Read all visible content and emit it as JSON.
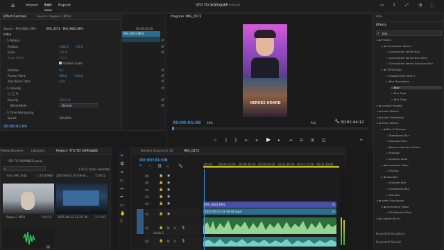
{
  "menu": {
    "import": "Import",
    "edit": "Edit",
    "export": "Export"
  },
  "title": "ЧТО ТО ХОРОШЕЕ",
  "title_status": "Edited",
  "effect_controls": {
    "tabs": [
      "Effect Controls",
      "Source: Видео 1.MOV"
    ],
    "source_path": "Source · MVI_9661.MP4",
    "seq_path": "IMG_0572 · MVI_9661.MP4",
    "time_ruler": "00:00:30:00",
    "clip_name": "MVI_9661.MP4",
    "section_video": "Video",
    "fx_motion": "Motion",
    "position_label": "Position",
    "position_x": "1080,0",
    "position_y": "729,0",
    "scale_label": "Scale",
    "scale_val": "117,0",
    "scale_width_label": "Scale Width",
    "scale_width_val": "100,0",
    "uniform_scale": "Uniform Scale",
    "rotation_label": "Rotation",
    "rotation_val": "0,0",
    "anchor_label": "Anchor Point",
    "anchor_x": "960,0",
    "anchor_y": "540,0",
    "antiflicker_label": "Anti-flicker Filter",
    "antiflicker_val": "0,00",
    "fx_opacity": "Opacity",
    "opacity_label": "Opacity",
    "opacity_val": "100,0 %",
    "blend_label": "Blend Mode",
    "blend_val": "Normal",
    "fx_remap": "Time Remapping",
    "speed_label": "Speed",
    "speed_val": "100,00%",
    "footer_tc": "00:00:01:06"
  },
  "program": {
    "title": "Program: IMG_0572",
    "tc_left": "00:00:01:06",
    "zoom": "16%",
    "quality": "Full",
    "tc_right": "00:01:44:12",
    "poster_text": "HEROES HOARD"
  },
  "info": {
    "title": "Info"
  },
  "effects": {
    "title": "Effects",
    "search": "blur",
    "items": [
      {
        "label": "Presets",
        "lvl": 0,
        "sel": false
      },
      {
        "label": "Convolution Kernel",
        "lvl": 1,
        "sel": false
      },
      {
        "label": "Convolution Kernel Blur",
        "lvl": 2,
        "sel": false
      },
      {
        "label": "Convolution Kernel Blur More",
        "lvl": 2,
        "sel": false
      },
      {
        "label": "Convolution Kernel Gaussian Blur",
        "lvl": 2,
        "sel": false
      },
      {
        "label": "ПЕРЕХОДЫ",
        "lvl": 1,
        "sel": false
      },
      {
        "label": "TRANSITION PACK 3",
        "lvl": 2,
        "sel": false
      },
      {
        "label": "Blur Transitions",
        "lvl": 2,
        "sel": false
      },
      {
        "label": "Blur",
        "lvl": 3,
        "sel": true
      },
      {
        "label": "Blur Fade",
        "lvl": 3,
        "sel": false
      },
      {
        "label": "Blur Glow",
        "lvl": 3,
        "sel": false
      },
      {
        "label": "Lumetri Presets",
        "lvl": 0,
        "sel": false
      },
      {
        "label": "Audio Effects",
        "lvl": 0,
        "sel": false
      },
      {
        "label": "Audio Transitions",
        "lvl": 0,
        "sel": false
      },
      {
        "label": "Video Effects",
        "lvl": 0,
        "sel": false
      },
      {
        "label": "Blur & Sharpen",
        "lvl": 1,
        "sel": false
      },
      {
        "label": "Directional Blur",
        "lvl": 2,
        "sel": false
      },
      {
        "label": "Gaussian Blur",
        "lvl": 2,
        "sel": false
      },
      {
        "label": "Reduce Interlace Flicker",
        "lvl": 2,
        "sel": false
      },
      {
        "label": "Sharpen",
        "lvl": 2,
        "sel": false
      },
      {
        "label": "Unsharp Mask",
        "lvl": 2,
        "sel": false
      },
      {
        "label": "Immersive Video",
        "lvl": 1,
        "sel": false
      },
      {
        "label": "VR Blur",
        "lvl": 2,
        "sel": false
      },
      {
        "label": "Obsolete",
        "lvl": 1,
        "sel": false
      },
      {
        "label": "Channel Blur",
        "lvl": 2,
        "sel": false
      },
      {
        "label": "Compound Blur",
        "lvl": 2,
        "sel": false
      },
      {
        "label": "Fast Blur",
        "lvl": 2,
        "sel": false
      },
      {
        "label": "Video Transitions",
        "lvl": 0,
        "sel": false
      },
      {
        "label": "Immersive Video",
        "lvl": 1,
        "sel": false
      },
      {
        "label": "VR Spherical Blur",
        "lvl": 2,
        "sel": false
      },
      {
        "label": "Custom Bin 01",
        "lvl": 0,
        "sel": false
      }
    ],
    "essential_graphics": "Essential Graphics",
    "essential_sound": "Essential Sound"
  },
  "project": {
    "tabs": [
      "Media Browser",
      "Libraries",
      "Project: ЧТО ТО ХОРОШЕЕ"
    ],
    "file": "ЧТО ТО ХОРОШЕЕ.prproj",
    "count": "1 of 21 items selected",
    "items": [
      {
        "name": "Тон 1 AIC.m4a",
        "dur": "1:43:02944"
      },
      {
        "name": "2025-06-21 01-58-44...",
        "dur": "1:39:12"
      },
      {
        "name": "Видео 1.MOV",
        "dur": "1:45:22"
      },
      {
        "name": "2025-06-21 13-25-34...",
        "dur": "2:11:43"
      }
    ]
  },
  "timeline": {
    "tabs": [
      "Nested Sequence 34",
      "IMG_0572"
    ],
    "tc": "00:00:01:06",
    "ruler": [
      ":00:00",
      "00:00:15:00",
      "00:00:30:00",
      "00:00:45:00",
      "00:01:00:00",
      "00:01:15:00",
      "00:01:30:00",
      "00:01:45:00"
    ],
    "tracks": [
      "V6",
      "V5",
      "V4",
      "V3",
      "V2",
      "V1",
      "A1",
      "A2"
    ],
    "clip_v2": "MVI_9661.MP4",
    "clip_v1": "2025-06-21 01-58-44.mp4",
    "audio_label": "Audio 1"
  }
}
